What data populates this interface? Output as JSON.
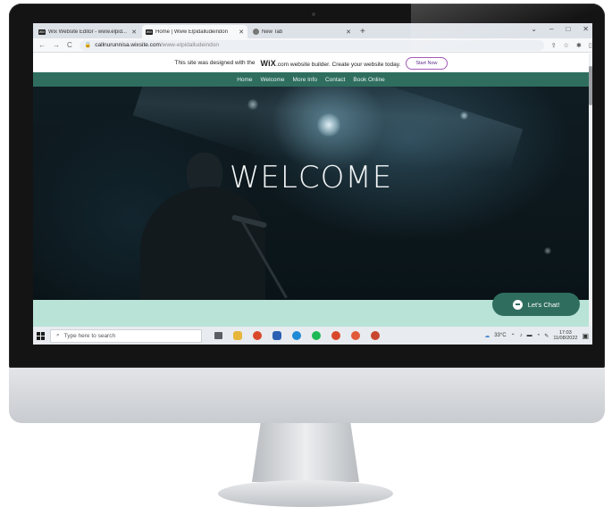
{
  "browser": {
    "tabs": [
      {
        "favicon": "WIX",
        "title": "Wix Website Editor - www.elpid...",
        "active": false
      },
      {
        "favicon": "WIX",
        "title": "Home | Www Elpidalludeindon",
        "active": true
      },
      {
        "favicon": "",
        "title": "New Tab",
        "active": false
      }
    ],
    "new_tab": "+",
    "window_controls": [
      "⌄",
      "–",
      "□",
      "✕"
    ],
    "nav": {
      "back": "←",
      "forward": "→",
      "reload": "C"
    },
    "url_host": "callnurunnisa.wixsite.com",
    "url_path": "/www-elpidalludeindon",
    "toolbar_icons": [
      "⇪",
      "☆",
      "✱",
      "▯",
      "●",
      "⋮"
    ]
  },
  "wix_banner": {
    "text_before": "This site was designed with the",
    "logo": "WiX",
    "text_after": ".com website builder. Create your website today.",
    "cta": "Start Now"
  },
  "site_nav": [
    "Home",
    "Welcome",
    "More Info",
    "Contact",
    "Book Online"
  ],
  "hero": {
    "headline": "WELCOME"
  },
  "chat": {
    "label": "Let's Chat!"
  },
  "taskbar": {
    "search_placeholder": "Type here to search",
    "apps": [
      {
        "name": "task-view",
        "color": "#5a5f66"
      },
      {
        "name": "file-explorer",
        "color": "#e6b53a"
      },
      {
        "name": "chrome",
        "color": "#d9472b"
      },
      {
        "name": "word",
        "color": "#2b5fb3"
      },
      {
        "name": "edge",
        "color": "#1f8ad6"
      },
      {
        "name": "spotify",
        "color": "#1db954"
      },
      {
        "name": "chrome-2",
        "color": "#d9472b"
      },
      {
        "name": "chrome-3",
        "color": "#e25a3a"
      },
      {
        "name": "chrome-4",
        "color": "#c9472f"
      }
    ],
    "weather": "33°C",
    "time": "17:03",
    "date": "11/08/2022"
  },
  "colors": {
    "accent_green": "#2f6e5f",
    "mint": "#b8e3d6",
    "cta_purple": "#a55ab8"
  }
}
